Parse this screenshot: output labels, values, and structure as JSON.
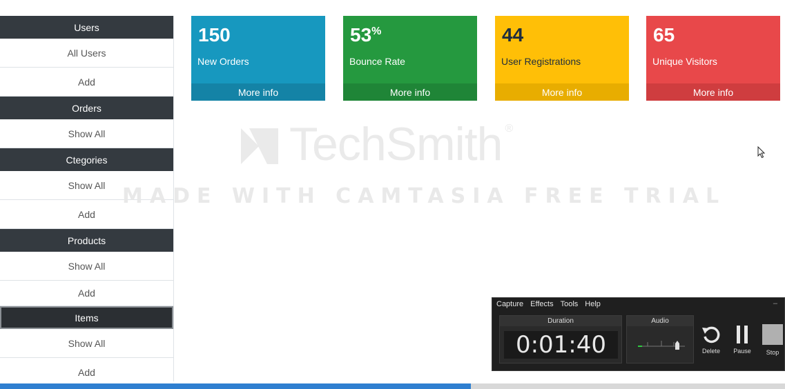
{
  "sidebar": {
    "sections": [
      {
        "header": "Users",
        "items": [
          "All Users",
          "Add"
        ]
      },
      {
        "header": "Orders",
        "items": [
          "Show All"
        ]
      },
      {
        "header": "Ctegories",
        "items": [
          "Show All",
          "Add"
        ]
      },
      {
        "header": "Products",
        "items": [
          "Show All",
          "Add"
        ]
      },
      {
        "header": "Items",
        "items": [
          "Show All",
          "Add"
        ]
      }
    ]
  },
  "boxes": [
    {
      "value": "150",
      "suffix": "",
      "label": "New Orders",
      "more": "More info",
      "color": "#1798bf"
    },
    {
      "value": "53",
      "suffix": "%",
      "label": "Bounce Rate",
      "more": "More info",
      "color": "#25993f"
    },
    {
      "value": "44",
      "suffix": "",
      "label": "User Registrations",
      "more": "More info",
      "color": "#ffbf07"
    },
    {
      "value": "65",
      "suffix": "",
      "label": "Unique Visitors",
      "more": "More info",
      "color": "#e8484a"
    }
  ],
  "watermark": {
    "brand": "TechSmith",
    "reg": "®",
    "tagline": "MADE WITH CAMTASIA FREE TRIAL"
  },
  "recorder": {
    "menu": [
      "Capture",
      "Effects",
      "Tools",
      "Help"
    ],
    "duration_label": "Duration",
    "duration_value": "0:01:40",
    "audio_label": "Audio",
    "delete_label": "Delete",
    "pause_label": "Pause",
    "stop_label": "Stop"
  },
  "progress": {
    "fraction": 0.6
  },
  "icons": {
    "cursor": "mouse-pointer-icon",
    "delete": "undo-icon",
    "pause": "pause-icon",
    "stop": "stop-icon"
  }
}
